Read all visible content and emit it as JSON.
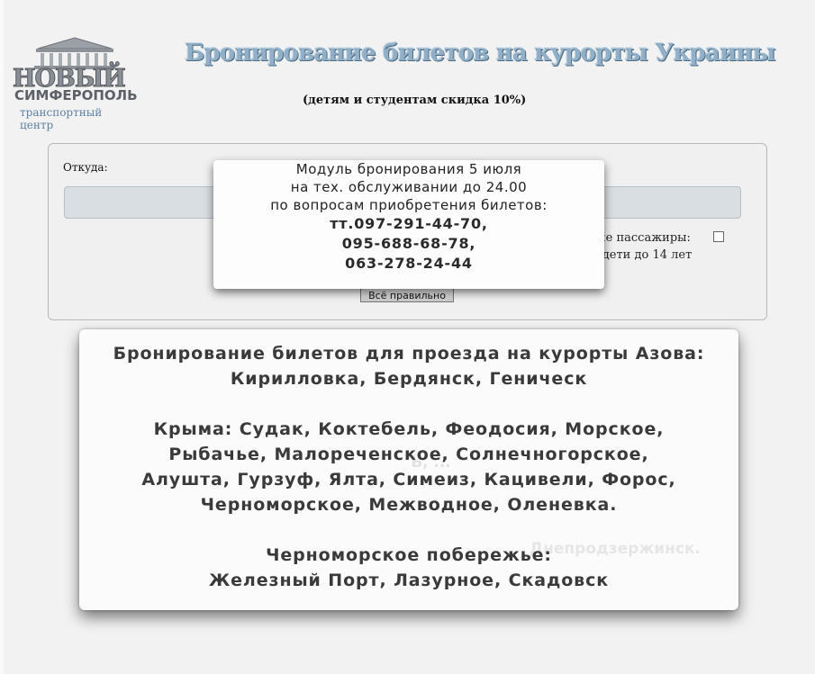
{
  "logo": {
    "name": "НОВЫЙ",
    "city": "СИМФЕРОПОЛЬ",
    "subtitle": "транспортный центр"
  },
  "header": {
    "title": "Бронирование билетов на курорты Украины",
    "discount": "(детям и студентам скидка 10%)"
  },
  "form": {
    "from_label": "Откуда:",
    "from_value": "",
    "option1_label": "ие пассажиры:",
    "option2_label": "и дети до 14 лет",
    "submit_label": "Всё правильно"
  },
  "notice": {
    "line1": "Модуль бронирования 5 июля",
    "line2": "на тех. обслуживании до 24.00",
    "line3": "по вопросам приобретения билетов:",
    "phone1": "тт.097-291-44-70,",
    "phone2": "095-688-68-78,",
    "phone3": "063-278-24-44"
  },
  "resorts": {
    "azov_heading": "Бронирование билетов для проезда на курорты Азова:",
    "azov_list": "Кирилловка, Бердянск, Геническ",
    "crimea_line1": "Крыма: Судак, Коктебель, Феодосия, Морское,",
    "crimea_line2": "Рыбачье, Малореченское, Солнечногорское,",
    "crimea_line3": "Алушта, Гурзуф, Ялта, Симеиз, Кацивели, Форос,",
    "crimea_line4": "Черноморское, Межводное, Оленевка.",
    "black_sea_heading": "Черноморское побережье:",
    "black_sea_list": "Железный Порт, Лазурное, Скадовск",
    "ghost1": "Ъ, ...",
    "ghost2": "Днепродзержинск."
  }
}
